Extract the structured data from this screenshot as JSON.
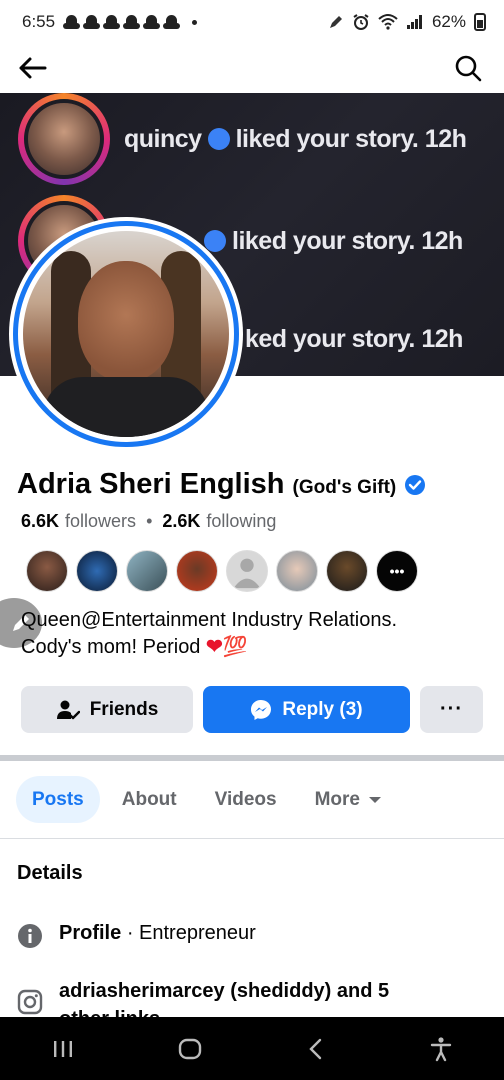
{
  "status_bar": {
    "time": "6:55",
    "battery": "62%"
  },
  "cover": {
    "lines": [
      {
        "name": "quincy",
        "text": "liked your story. 12h"
      },
      {
        "name": "",
        "text": "liked your story. 12h"
      },
      {
        "name": "",
        "text": "ked your story. 12h"
      }
    ]
  },
  "profile": {
    "name": "Adria Sheri English",
    "nickname": "(God's Gift)",
    "followers_count": "6.6K",
    "followers_label": "followers",
    "separator": "•",
    "following_count": "2.6K",
    "following_label": "following",
    "bio_line1": "Queen@Entertainment Industry Relations.",
    "bio_line2": "Cody's mom! Period",
    "bio_emoji_heart": "❤",
    "bio_emoji_100": "💯"
  },
  "buttons": {
    "friends": "Friends",
    "reply": "Reply (3)",
    "more": "···"
  },
  "tabs": {
    "posts": "Posts",
    "about": "About",
    "videos": "Videos",
    "more": "More"
  },
  "details": {
    "title": "Details",
    "profile_label": "Profile",
    "profile_value": "· Entrepreneur",
    "links_text": "adriasherimarcey (shediddy) and 5",
    "links_text_2": "other links"
  },
  "friend_avatars": [
    "#3b2e2a",
    "#0d2a55",
    "#5d7a86",
    "#b23a1e",
    "#d3d3d3",
    "#c9b2a4",
    "#4a3a2a",
    "#111111"
  ],
  "colors": {
    "accent": "#1877f2",
    "secondary_text": "#65676b",
    "button_gray": "#e4e6eb"
  }
}
